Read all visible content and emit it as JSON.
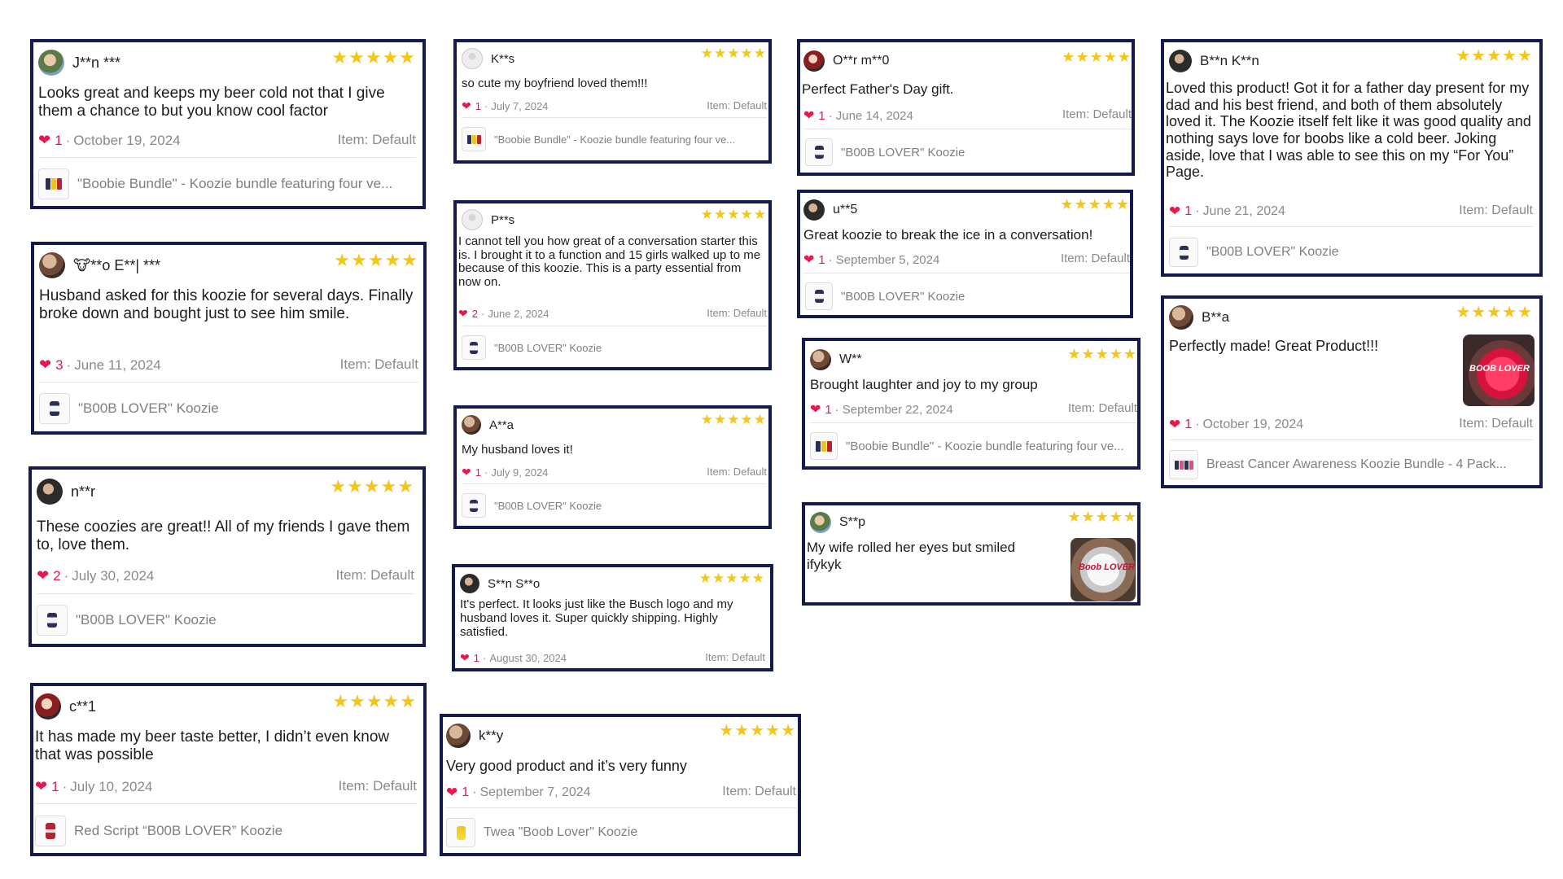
{
  "reviews": [
    {
      "name": "J**n ***",
      "text": "Looks great and keeps my beer cold not that I give them a chance to but you know cool factor",
      "likes": "1",
      "date": "October 19, 2024",
      "item": "Item: Default",
      "product": "\"Boobie Bundle\" - Koozie bundle featuring four ve...",
      "stars": "★★★★★"
    },
    {
      "name": "🐮**o E**| ***",
      "text": "Husband asked for this koozie for several days. Finally broke down and bought just to see him smile.",
      "likes": "3",
      "date": "June 11, 2024",
      "item": "Item: Default",
      "product": "\"B00B LOVER\" Koozie",
      "stars": "★★★★★"
    },
    {
      "name": "n**r",
      "text": "These coozies are great!! All of my friends I gave them to, love them.",
      "likes": "2",
      "date": "July 30, 2024",
      "item": "Item: Default",
      "product": "\"B00B LOVER\" Koozie",
      "stars": "★★★★★"
    },
    {
      "name": "c**1",
      "text": "It has made my beer taste better, I didn’t even know that was possible",
      "likes": "1",
      "date": "July 10, 2024",
      "item": "Item: Default",
      "product": "Red Script “B00B LOVER” Koozie",
      "stars": "★★★★★"
    },
    {
      "name": "K**s",
      "text": "so cute my boyfriend loved them!!!",
      "likes": "1",
      "date": "July 7, 2024",
      "item": "Item: Default",
      "product": "\"Boobie Bundle\" - Koozie bundle featuring four ve...",
      "stars": "★★★★★"
    },
    {
      "name": "P**s",
      "text": "I cannot tell you how great of a conversation starter this is. I brought it to a function and 15 girls walked up to me because of this koozie. This is a party essential from now on.",
      "likes": "2",
      "date": "June 2, 2024",
      "item": "Item: Default",
      "product": "\"B00B LOVER\" Koozie",
      "stars": "★★★★★"
    },
    {
      "name": "A**a",
      "text": "My husband loves it!",
      "likes": "1",
      "date": "July 9, 2024",
      "item": "Item: Default",
      "product": "\"B00B LOVER\" Koozie",
      "stars": "★★★★★"
    },
    {
      "name": "S**n S**o",
      "text": "It's perfect. It looks just like the Busch logo and my husband loves it. Super quickly shipping. Highly satisfied.",
      "likes": "1",
      "date": "August 30, 2024",
      "item": "Item: Default",
      "product": "",
      "stars": "★★★★★"
    },
    {
      "name": "k**y",
      "text": "Very good product and it’s very funny",
      "likes": "1",
      "date": "September 7, 2024",
      "item": "Item: Default",
      "product": "Twea \"Boob Lover\" Koozie",
      "stars": "★★★★★"
    },
    {
      "name": "O**r m**0",
      "text": "Perfect Father's Day gift.",
      "likes": "1",
      "date": "June 14, 2024",
      "item": "Item: Default",
      "product": "\"B00B LOVER\" Koozie",
      "stars": "★★★★★"
    },
    {
      "name": "u**5",
      "text": "Great koozie to break the ice in a conversation!",
      "likes": "1",
      "date": "September 5, 2024",
      "item": "Item: Default",
      "product": "\"B00B LOVER\" Koozie",
      "stars": "★★★★★"
    },
    {
      "name": "W**",
      "text": "Brought laughter and joy to my group",
      "likes": "1",
      "date": "September 22, 2024",
      "item": "Item: Default",
      "product": "\"Boobie Bundle\" - Koozie bundle featuring four ve...",
      "stars": "★★★★★"
    },
    {
      "name": "S**p",
      "text": "My wife rolled her eyes but smiled ifykyk",
      "likes": "",
      "date": "",
      "item": "",
      "product": "",
      "stars": "★★★★★",
      "photo_label": "Boob LOVER"
    },
    {
      "name": "B**n K**n",
      "text": "Loved this product! Got it for a father day present for my dad and his best friend, and both of them absolutely loved it. The Koozie itself felt like it was good quality and nothing says love for boobs like a cold beer. Joking aside, love that I was able to see this on my “For You” Page.",
      "likes": "1",
      "date": "June 21, 2024",
      "item": "Item: Default",
      "product": "\"B00B LOVER\" Koozie",
      "stars": "★★★★★"
    },
    {
      "name": "B**a",
      "text": "Perfectly made! Great Product!!!",
      "likes": "1",
      "date": "October 19, 2024",
      "item": "Item: Default",
      "product": "Breast Cancer Awareness Koozie Bundle - 4 Pack...",
      "stars": "★★★★★",
      "photo_label": "BOOB LOVER"
    }
  ],
  "separator": "·",
  "icons": {
    "heart": "heart-icon",
    "star": "star-icon",
    "avatar": "avatar"
  },
  "colors": {
    "border": "#141a4d",
    "star": "#f5c518",
    "heart": "#e8174f",
    "muted": "#8a8a8a"
  }
}
